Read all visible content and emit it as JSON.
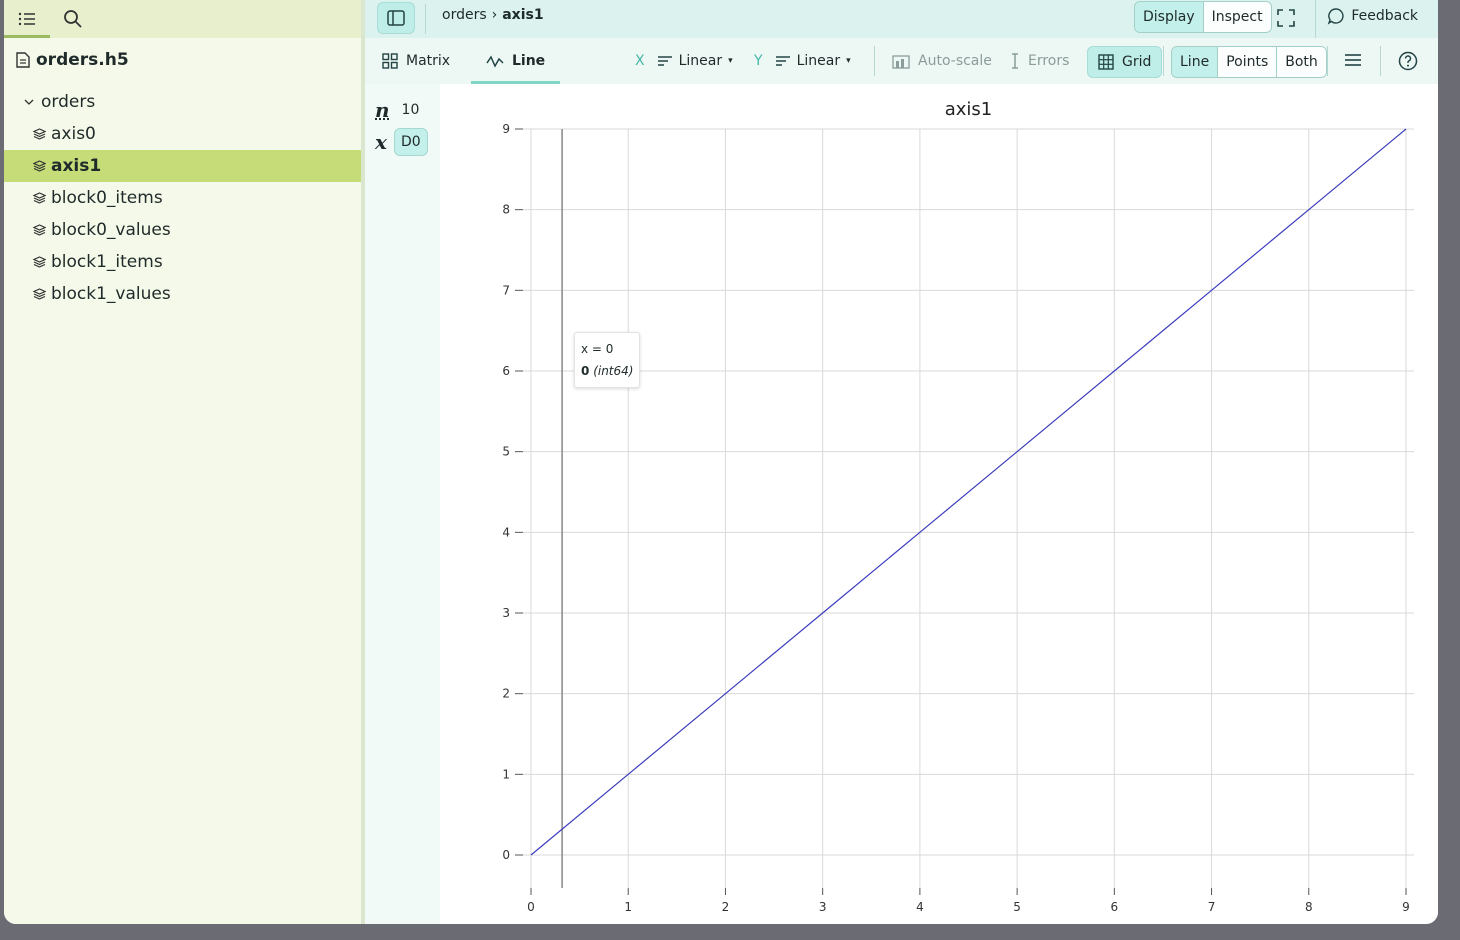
{
  "sidebar": {
    "filename": "orders.h5",
    "group": "orders",
    "items": [
      {
        "label": "axis0",
        "selected": false
      },
      {
        "label": "axis1",
        "selected": true
      },
      {
        "label": "block0_items",
        "selected": false
      },
      {
        "label": "block0_values",
        "selected": false
      },
      {
        "label": "block1_items",
        "selected": false
      },
      {
        "label": "block1_values",
        "selected": false
      }
    ]
  },
  "breadcrumb": {
    "parent": "orders",
    "current": "axis1"
  },
  "topbar": {
    "display": "Display",
    "inspect": "Inspect",
    "feedback": "Feedback"
  },
  "toolbar": {
    "matrix": "Matrix",
    "line": "Line",
    "x_letter": "X",
    "x_scale": "Linear",
    "y_letter": "Y",
    "y_scale": "Linear",
    "autoscale": "Auto-scale",
    "errors": "Errors",
    "grid": "Grid",
    "mode_line": "Line",
    "mode_points": "Points",
    "mode_both": "Both"
  },
  "dims": {
    "n_label": "n",
    "n_value": "10",
    "x_label": "x",
    "x_dim": "D0"
  },
  "tooltip": {
    "x_text": "x = 0",
    "value": "0",
    "dtype": "(int64)"
  },
  "colors": {
    "line": "#3c3cbe",
    "accent": "#bfeee9",
    "selected": "#c5dc78"
  },
  "chart_data": {
    "type": "line",
    "title": "axis1",
    "x": [
      0,
      1,
      2,
      3,
      4,
      5,
      6,
      7,
      8,
      9
    ],
    "values": [
      0,
      1,
      2,
      3,
      4,
      5,
      6,
      7,
      8,
      9
    ],
    "x_ticks": [
      "0",
      "1",
      "2",
      "3",
      "4",
      "5",
      "6",
      "7",
      "8",
      "9"
    ],
    "y_ticks": [
      "0",
      "1",
      "2",
      "3",
      "4",
      "5",
      "6",
      "7",
      "8",
      "9"
    ],
    "xlim": [
      0,
      9
    ],
    "ylim": [
      0,
      9
    ],
    "grid": true
  }
}
